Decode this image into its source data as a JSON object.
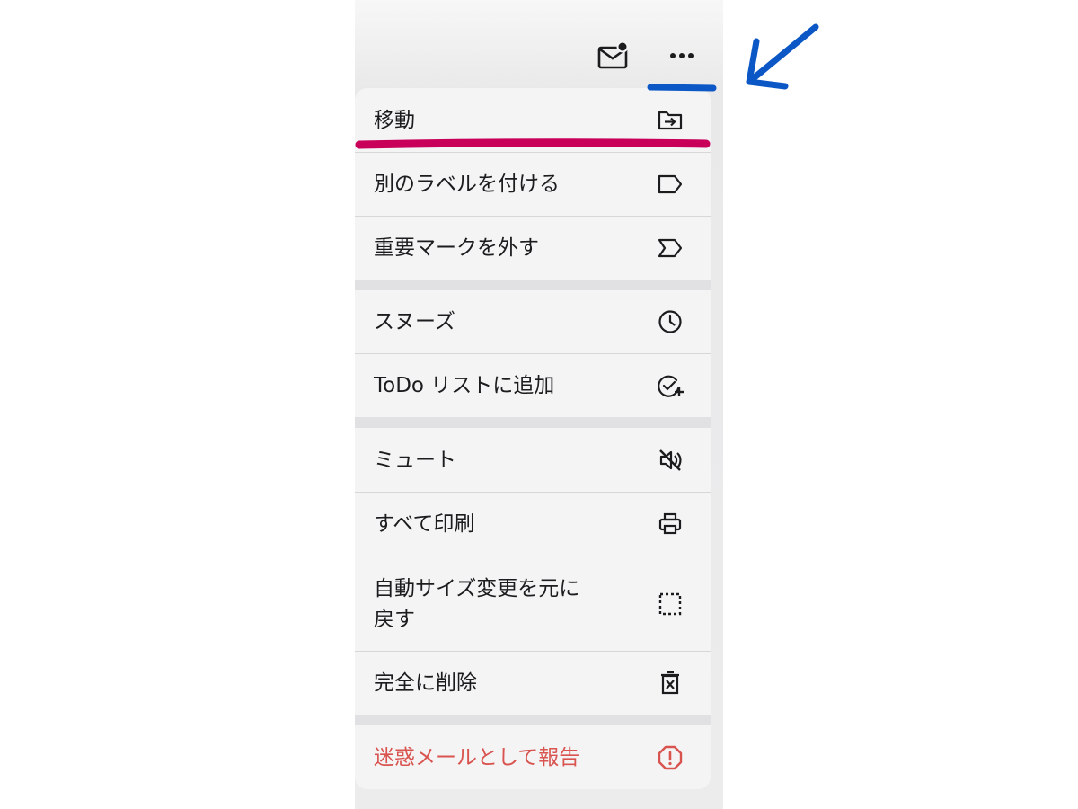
{
  "toolbar": {
    "mark_unread_icon": "mail-unread-icon",
    "more_icon": "more-horizontal-icon"
  },
  "menu": {
    "items": [
      {
        "label": "移動",
        "icon": "folder-move-icon"
      },
      {
        "label": "別のラベルを付ける",
        "icon": "label-icon"
      },
      {
        "label": "重要マークを外す",
        "icon": "important-icon"
      },
      {
        "label": "スヌーズ",
        "icon": "clock-icon"
      },
      {
        "label": "ToDo リストに追加",
        "icon": "add-task-icon"
      },
      {
        "label": "ミュート",
        "icon": "mute-icon"
      },
      {
        "label": "すべて印刷",
        "icon": "print-icon"
      },
      {
        "label": "自動サイズ変更を元に戻す",
        "icon": "resize-dotted-icon"
      },
      {
        "label": "完全に削除",
        "icon": "delete-forever-icon"
      },
      {
        "label": "迷惑メールとして報告",
        "icon": "report-spam-icon"
      }
    ]
  },
  "colors": {
    "text": "#1c1c1e",
    "danger": "#d9534f",
    "annotation_blue": "#0b57c6",
    "annotation_magenta": "#c8005a"
  }
}
